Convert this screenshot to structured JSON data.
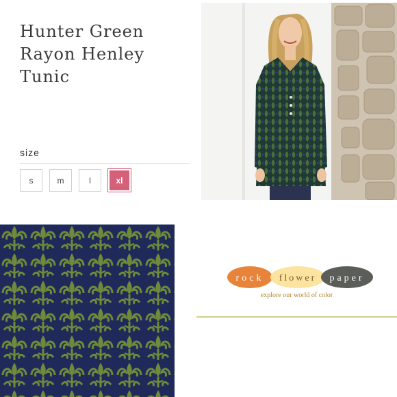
{
  "product": {
    "title_lines": [
      "Hunter Green",
      "Rayon Henley",
      "Tunic"
    ]
  },
  "size_selector": {
    "label": "size",
    "options": [
      "s",
      "m",
      "l",
      "xl"
    ],
    "selected": "xl",
    "selected_color": "#d4607a"
  },
  "brand": {
    "logo_words": [
      "rock",
      "flower",
      "paper"
    ],
    "logo_colors": [
      "#e8843a",
      "#fde3a0",
      "#5b5e58"
    ],
    "tagline": "explore our world of color"
  },
  "colors": {
    "fabric_navy": "#1f2a5a",
    "fabric_green": "#6f8a3a"
  }
}
